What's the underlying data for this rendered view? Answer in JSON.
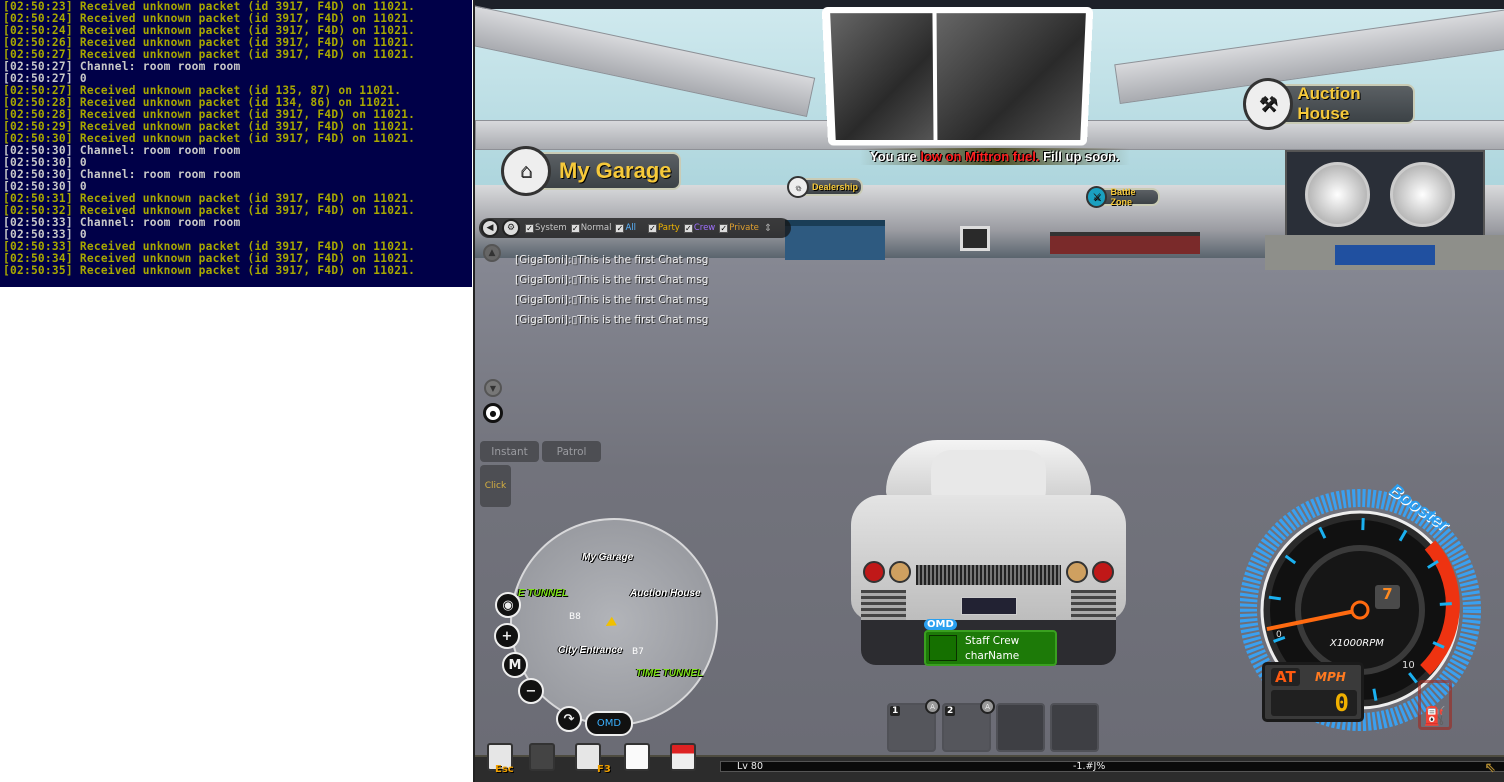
{
  "console": {
    "lines": [
      {
        "time": "[02:50:23]",
        "text": "Received unknown packet (id 3917, F4D) on 11021.",
        "color": "yellow"
      },
      {
        "time": "[02:50:24]",
        "text": "Received unknown packet (id 3917, F4D) on 11021.",
        "color": "yellow"
      },
      {
        "time": "[02:50:24]",
        "text": "Received unknown packet (id 3917, F4D) on 11021.",
        "color": "yellow"
      },
      {
        "time": "[02:50:26]",
        "text": "Received unknown packet (id 3917, F4D) on 11021.",
        "color": "yellow"
      },
      {
        "time": "[02:50:27]",
        "text": "Received unknown packet (id 3917, F4D) on 11021.",
        "color": "yellow"
      },
      {
        "time": "[02:50:27]",
        "text": "Channel: room room room",
        "color": "white"
      },
      {
        "time": "[02:50:27]",
        "text": "0",
        "color": "white"
      },
      {
        "time": "[02:50:27]",
        "text": "Received unknown packet (id 135, 87) on 11021.",
        "color": "yellow"
      },
      {
        "time": "[02:50:28]",
        "text": "Received unknown packet (id 134, 86) on 11021.",
        "color": "yellow"
      },
      {
        "time": "[02:50:28]",
        "text": "Received unknown packet (id 3917, F4D) on 11021.",
        "color": "yellow"
      },
      {
        "time": "[02:50:29]",
        "text": "Received unknown packet (id 3917, F4D) on 11021.",
        "color": "yellow"
      },
      {
        "time": "[02:50:30]",
        "text": "Received unknown packet (id 3917, F4D) on 11021.",
        "color": "yellow"
      },
      {
        "time": "[02:50:30]",
        "text": "Channel: room room room",
        "color": "white"
      },
      {
        "time": "[02:50:30]",
        "text": "0",
        "color": "white"
      },
      {
        "time": "[02:50:30]",
        "text": "Channel: room room room",
        "color": "white"
      },
      {
        "time": "[02:50:30]",
        "text": "0",
        "color": "white"
      },
      {
        "time": "[02:50:31]",
        "text": "Received unknown packet (id 3917, F4D) on 11021.",
        "color": "yellow"
      },
      {
        "time": "[02:50:32]",
        "text": "Received unknown packet (id 3917, F4D) on 11021.",
        "color": "yellow"
      },
      {
        "time": "[02:50:33]",
        "text": "Channel: room room room",
        "color": "white"
      },
      {
        "time": "[02:50:33]",
        "text": "0",
        "color": "white"
      },
      {
        "time": "[02:50:33]",
        "text": "Received unknown packet (id 3917, F4D) on 11021.",
        "color": "yellow"
      },
      {
        "time": "[02:50:34]",
        "text": "Received unknown packet (id 3917, F4D) on 11021.",
        "color": "yellow"
      },
      {
        "time": "[02:50:35]",
        "text": "Received unknown packet (id 3917, F4D) on 11021.",
        "color": "yellow"
      }
    ]
  },
  "game": {
    "signs": {
      "my_garage": "My Garage",
      "auction_house": "Auction House",
      "dealership": "Dealership",
      "battle_zone": "Battle Zone"
    },
    "notice": {
      "pre": "You are ",
      "highlight": "low on Mittron fuel.",
      "post": " Fill up soon."
    },
    "chat": {
      "filters": [
        {
          "label": "System",
          "color": "#c8c8c8"
        },
        {
          "label": "Normal",
          "color": "#c8c8c8"
        },
        {
          "label": "All",
          "color": "#5ab4ff"
        },
        {
          "label": "Party",
          "color": "#f0b400"
        },
        {
          "label": "Crew",
          "color": "#a070ff"
        },
        {
          "label": "Private",
          "color": "#e0a030"
        }
      ],
      "messages": [
        "[GigaToni]:▯This is the first Chat msg",
        "[GigaToni]:▯This is the first Chat msg",
        "[GigaToni]:▯This is the first Chat msg",
        "[GigaToni]:▯This is the first Chat msg"
      ]
    },
    "buttons": {
      "instant": "Instant",
      "patrol": "Patrol",
      "click": "Click"
    },
    "minimap": {
      "my_garage": "My Garage",
      "auction_house": "Auction House",
      "city_entrance": "City Entrance",
      "e_tunnel": "E TUNNEL",
      "time_tunnel": "TIME TUNNEL",
      "b8": "B8",
      "b7": "B7",
      "m": "M",
      "omd": "OMD"
    },
    "toolbar": {
      "esc": "Esc",
      "f3": "F3"
    },
    "hotbar": {
      "slot1": "1",
      "slot2": "2",
      "auto": "A"
    },
    "status": {
      "level": "Lv 80",
      "exp": "-1.#J%"
    },
    "nameplate": {
      "crew_tag": "OMD",
      "crew": "Staff Crew",
      "name": "charName"
    },
    "speedo": {
      "booster": "Booster",
      "gear": "7",
      "unit": "X1000RPM",
      "min": "0",
      "max": "10",
      "mode": "AT",
      "speed_unit": "MPH",
      "speed": "0",
      "rpm": 0.3,
      "boost_level": 1.0
    }
  }
}
